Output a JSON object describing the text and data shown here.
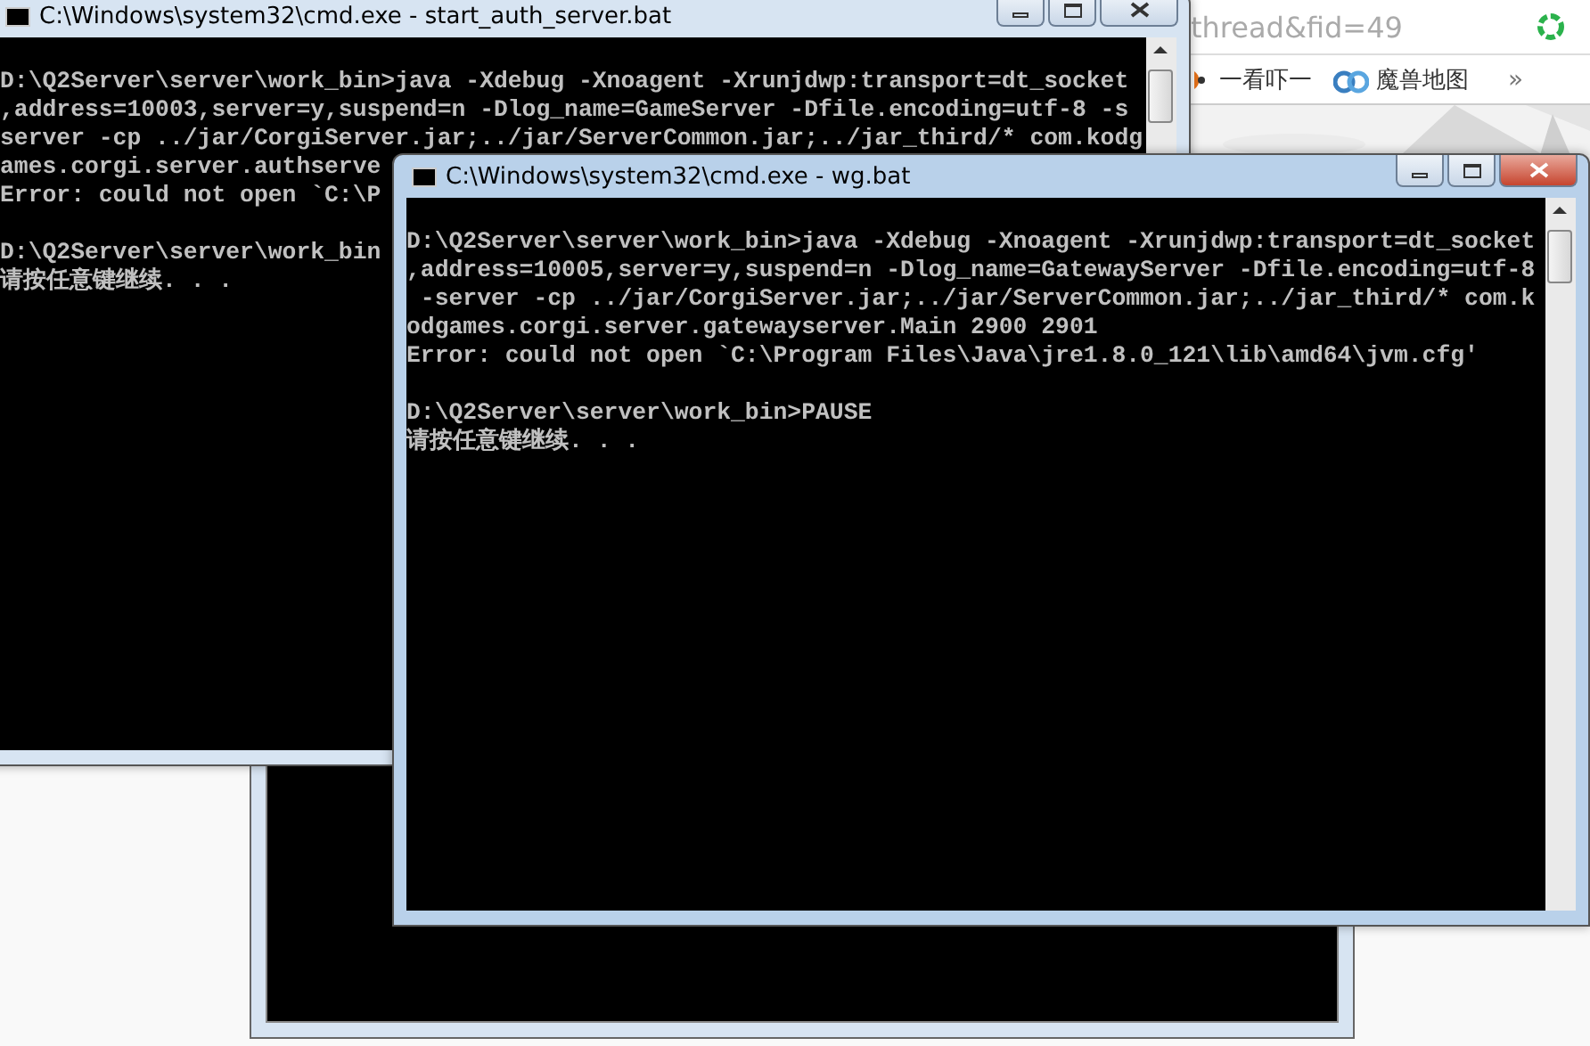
{
  "windows": [
    {
      "kind": "console",
      "title": "C:\\Windows\\system32\\cmd.exe - start_auth_server.bat",
      "active": false,
      "blocks": [
        [
          "D:\\Q2Server\\server\\work_bin>java -Xdebug -Xnoagent -Xrunjdwp:transport=dt_socket",
          ",address=10003,server=y,suspend=n -Dlog_name=GameServer -Dfile.encoding=utf-8 -s",
          "server -cp ../jar/CorgiServer.jar;../jar/ServerCommon.jar;../jar_third/* com.kodg",
          "ames.corgi.server.authserve",
          "Error: could not open `C:\\P"
        ],
        [
          "D:\\Q2Server\\server\\work_bin",
          "请按任意键继续. . ."
        ]
      ]
    },
    {
      "kind": "browser",
      "address": "thread&fid=49",
      "bookmarks": [
        {
          "label": "一看吓一"
        },
        {
          "label": "魔兽地图"
        }
      ],
      "more": "»"
    },
    {
      "kind": "blank-console"
    },
    {
      "kind": "console",
      "title": "C:\\Windows\\system32\\cmd.exe - wg.bat",
      "active": true,
      "blocks": [
        [
          "D:\\Q2Server\\server\\work_bin>java -Xdebug -Xnoagent -Xrunjdwp:transport=dt_socket",
          ",address=10005,server=y,suspend=n -Dlog_name=GatewayServer -Dfile.encoding=utf-8",
          " -server -cp ../jar/CorgiServer.jar;../jar/ServerCommon.jar;../jar_third/* com.k",
          "odgames.corgi.server.gatewayserver.Main 2900 2901",
          "Error: could not open `C:\\Program Files\\Java\\jre1.8.0_121\\lib\\amd64\\jvm.cfg'"
        ],
        [
          "D:\\Q2Server\\server\\work_bin>PAUSE",
          "请按任意键继续. . ."
        ]
      ]
    }
  ]
}
